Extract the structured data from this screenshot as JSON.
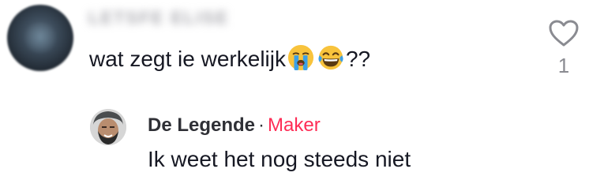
{
  "comment": {
    "username_blurred": "LETSFE ELISE",
    "text": "wat zegt ie werkelijk",
    "emojis": [
      "loudly-crying-face-emoji",
      "face-with-tears-of-joy-emoji"
    ],
    "suffix": "??",
    "like_icon": "heart-outline-icon",
    "like_count": "1"
  },
  "reply": {
    "author": "De Legende",
    "separator": "·",
    "badge": "Maker",
    "text": "Ik weet het nog steeds niet"
  },
  "colors": {
    "text_primary": "#161823",
    "text_secondary": "#8a8b91",
    "maker_badge": "#fe2c55",
    "emoji_yellow": "#f8c33c",
    "tear_blue": "#3ca0e6"
  }
}
